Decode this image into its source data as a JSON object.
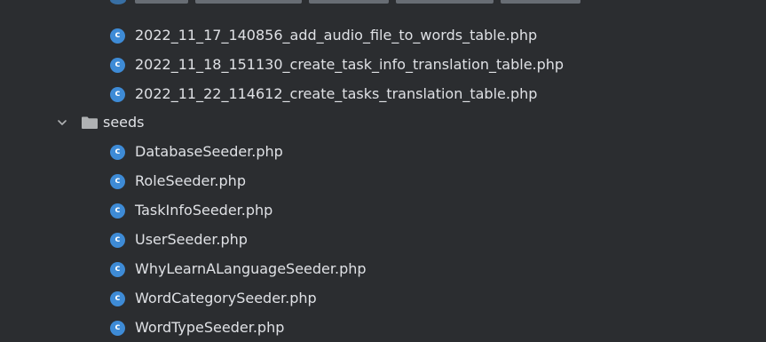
{
  "file_icon": "php-class-icon",
  "file_icon_glyph": "c",
  "folder_icon": "folder-icon",
  "expand_icon": "chevron-down-icon",
  "colors": {
    "background": "#2b2d30",
    "text": "#dfe1e5",
    "php_icon": "#3e8bd6",
    "folder": "#afb1b3"
  },
  "migrations": [
    "2022_11_17_140856_add_audio_file_to_words_table.php",
    "2022_11_18_151130_create_task_info_translation_table.php",
    "2022_11_22_114612_create_tasks_translation_table.php"
  ],
  "seeds_folder": {
    "name": "seeds",
    "expanded": true,
    "files": [
      "DatabaseSeeder.php",
      "RoleSeeder.php",
      "TaskInfoSeeder.php",
      "UserSeeder.php",
      "WhyLearnALanguageSeeder.php",
      "WordCategorySeeder.php",
      "WordTypeSeeder.php"
    ]
  }
}
